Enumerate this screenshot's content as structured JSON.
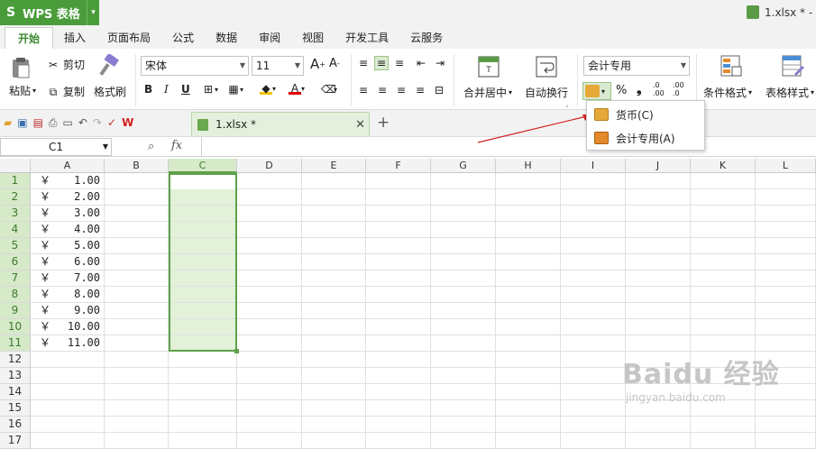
{
  "app": {
    "name": "WPS 表格",
    "logo_glyph": "S",
    "dropdown_glyph": "▾"
  },
  "window": {
    "file_title": "1.xlsx * -"
  },
  "tabs": [
    "开始",
    "插入",
    "页面布局",
    "公式",
    "数据",
    "审阅",
    "视图",
    "开发工具",
    "云服务"
  ],
  "ribbon": {
    "paste": "粘贴",
    "cut": "剪切",
    "copy": "复制",
    "format_painter": "格式刷",
    "font_name": "宋体",
    "font_size": "11",
    "bold": "B",
    "italic": "I",
    "underline": "U",
    "merge_center": "合并居中",
    "wrap_text": "自动换行",
    "number_format": "会计专用",
    "percent": "%",
    "comma": "❟",
    "inc_decimal": ".0\n.00",
    "dec_decimal": ".00\n.0",
    "conditional_format": "条件格式",
    "table_style": "表格样式",
    "grow_font": "A",
    "shrink_font": "A",
    "font_color_letter": "A"
  },
  "quickbar": {
    "doc_tab": "1.xlsx *",
    "add_tab": "+"
  },
  "formula_bar": {
    "name_box": "C1",
    "fx": "fx"
  },
  "columns": [
    "A",
    "B",
    "C",
    "D",
    "E",
    "F",
    "G",
    "H",
    "I",
    "J",
    "K",
    "L"
  ],
  "selected_column": "C",
  "rows": [
    {
      "n": "1",
      "sym": "￥",
      "val": "1.00"
    },
    {
      "n": "2",
      "sym": "￥",
      "val": "2.00"
    },
    {
      "n": "3",
      "sym": "￥",
      "val": "3.00"
    },
    {
      "n": "4",
      "sym": "￥",
      "val": "4.00"
    },
    {
      "n": "5",
      "sym": "￥",
      "val": "5.00"
    },
    {
      "n": "6",
      "sym": "￥",
      "val": "6.00"
    },
    {
      "n": "7",
      "sym": "￥",
      "val": "7.00"
    },
    {
      "n": "8",
      "sym": "￥",
      "val": "8.00"
    },
    {
      "n": "9",
      "sym": "￥",
      "val": "9.00"
    },
    {
      "n": "10",
      "sym": "￥",
      "val": "10.00"
    },
    {
      "n": "11",
      "sym": "￥",
      "val": "11.00"
    },
    {
      "n": "12",
      "sym": "",
      "val": ""
    },
    {
      "n": "13",
      "sym": "",
      "val": ""
    },
    {
      "n": "14",
      "sym": "",
      "val": ""
    },
    {
      "n": "15",
      "sym": "",
      "val": ""
    },
    {
      "n": "16",
      "sym": "",
      "val": ""
    },
    {
      "n": "17",
      "sym": "",
      "val": ""
    }
  ],
  "popup": {
    "items": [
      "货币(C)",
      "会计专用(A)"
    ]
  },
  "watermark": {
    "line1": "Baidu 经验",
    "line2": "jingyan.baidu.com"
  },
  "colors": {
    "accent": "#4a9c3a",
    "selection_fill": "#e2f1d8",
    "selection_border": "#5da04a",
    "arrow": "#d21f1f"
  }
}
